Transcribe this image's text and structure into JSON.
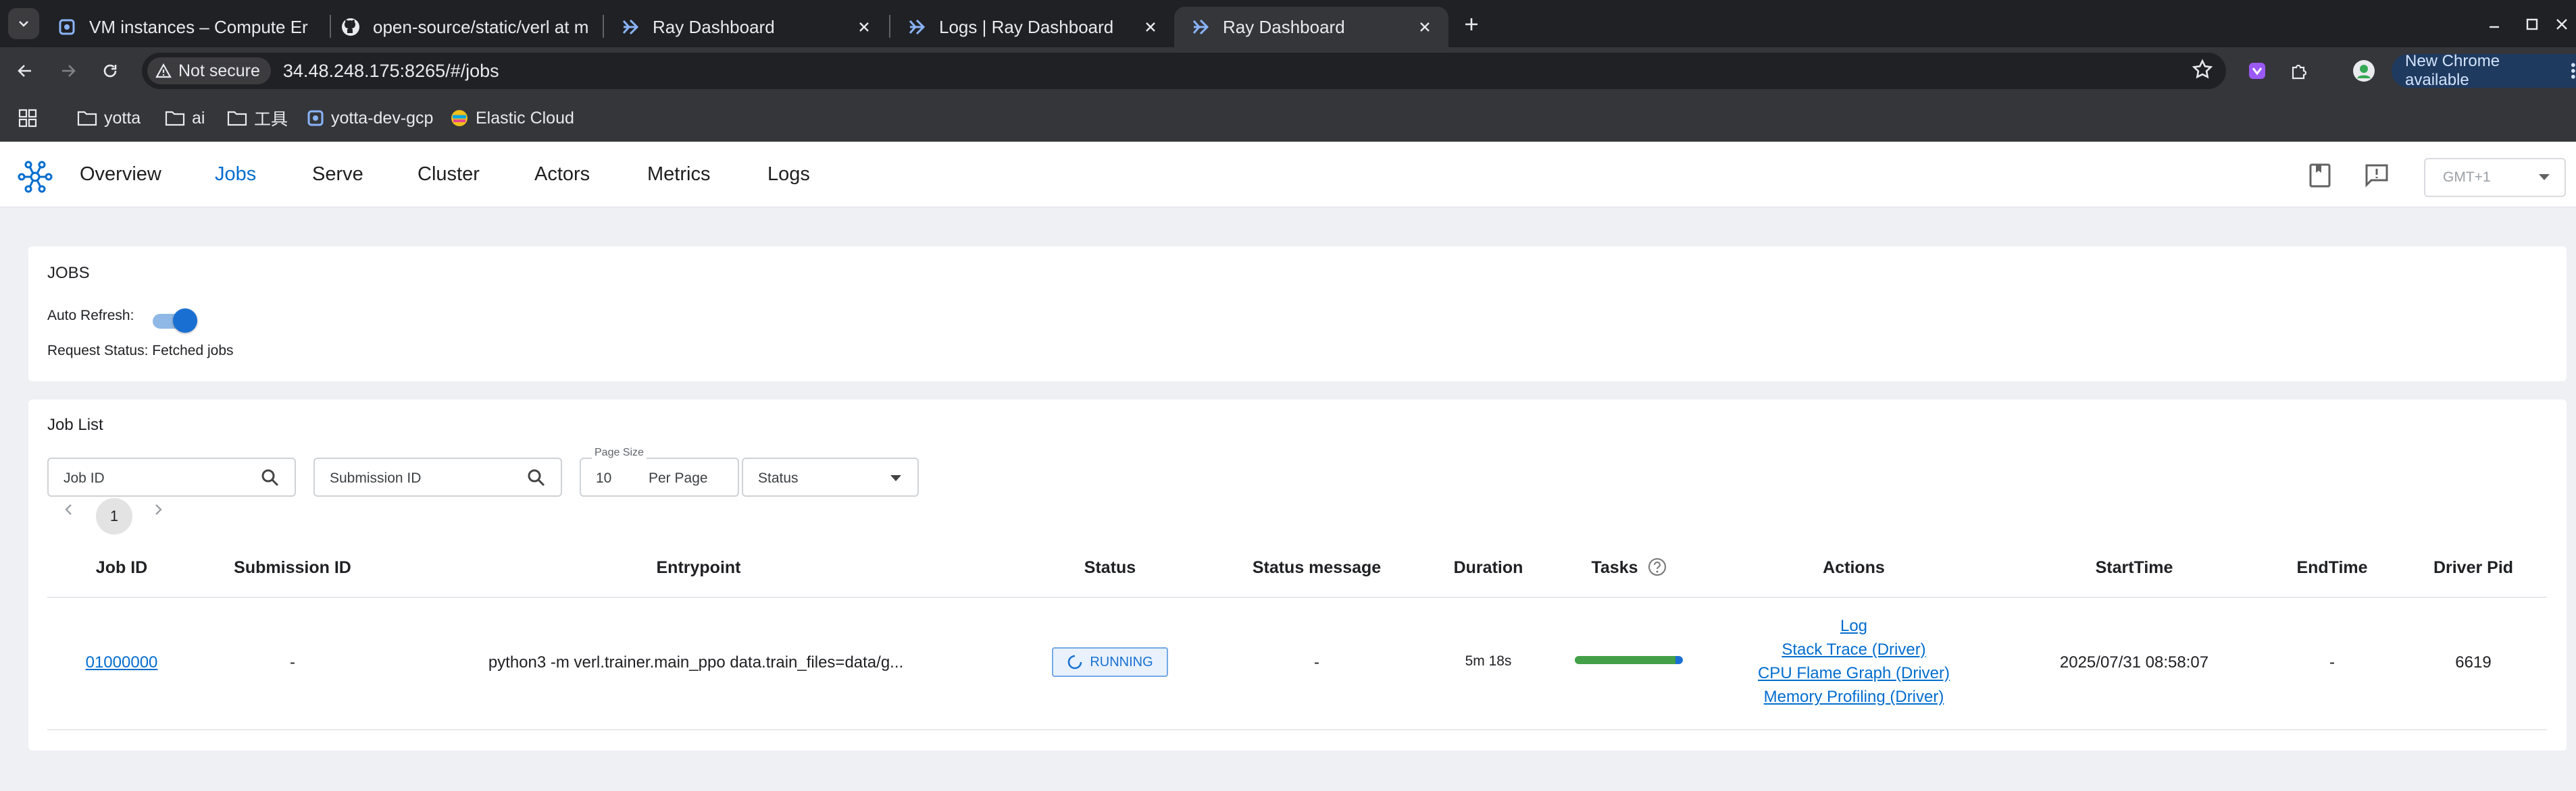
{
  "browser": {
    "tabs": [
      {
        "title": "VM instances – Compute Er",
        "favicon": "gcp-icon"
      },
      {
        "title": "open-source/static/verl at m",
        "favicon": "github-icon"
      },
      {
        "title": "Ray Dashboard",
        "favicon": "ray-icon"
      },
      {
        "title": "Logs | Ray Dashboard",
        "favicon": "ray-icon"
      },
      {
        "title": "Ray Dashboard",
        "favicon": "ray-icon",
        "active": true
      }
    ],
    "security_label": "Not secure",
    "url": "34.48.248.175:8265/#/jobs",
    "update_label": "New Chrome available",
    "bookmarks": [
      "yotta",
      "ai",
      "工具",
      "yotta-dev-gcp",
      "Elastic Cloud"
    ]
  },
  "app": {
    "nav": [
      "Overview",
      "Jobs",
      "Serve",
      "Cluster",
      "Actors",
      "Metrics",
      "Logs"
    ],
    "active_nav": "Jobs",
    "timezone": "GMT+1",
    "accent": "#036dcf"
  },
  "jobs_card": {
    "title": "JOBS",
    "auto_refresh_label": "Auto Refresh:",
    "auto_refresh_on": true,
    "request_status": "Request Status: Fetched jobs"
  },
  "job_list": {
    "title": "Job List",
    "job_id_placeholder": "Job ID",
    "submission_id_placeholder": "Submission ID",
    "page_size_label": "Page Size",
    "page_size": "10",
    "per_page_label": "Per Page",
    "status_placeholder": "Status",
    "current_page": "1",
    "columns": [
      "Job ID",
      "Submission ID",
      "Entrypoint",
      "Status",
      "Status message",
      "Duration",
      "Tasks",
      "Actions",
      "StartTime",
      "EndTime",
      "Driver Pid"
    ],
    "rows": [
      {
        "job_id": "01000000",
        "submission_id": "-",
        "entrypoint": "python3 -m verl.trainer.main_ppo data.train_files=data/g...",
        "status": "RUNNING",
        "status_message": "-",
        "duration": "5m 18s",
        "tasks_finished_fraction": 0.93,
        "tasks_running_fraction": 0.07,
        "actions": [
          "Log",
          "Stack Trace (Driver)",
          "CPU Flame Graph (Driver)",
          "Memory Profiling (Driver)"
        ],
        "start_time": "2025/07/31 08:58:07",
        "end_time": "-",
        "driver_pid": "6619"
      }
    ]
  }
}
